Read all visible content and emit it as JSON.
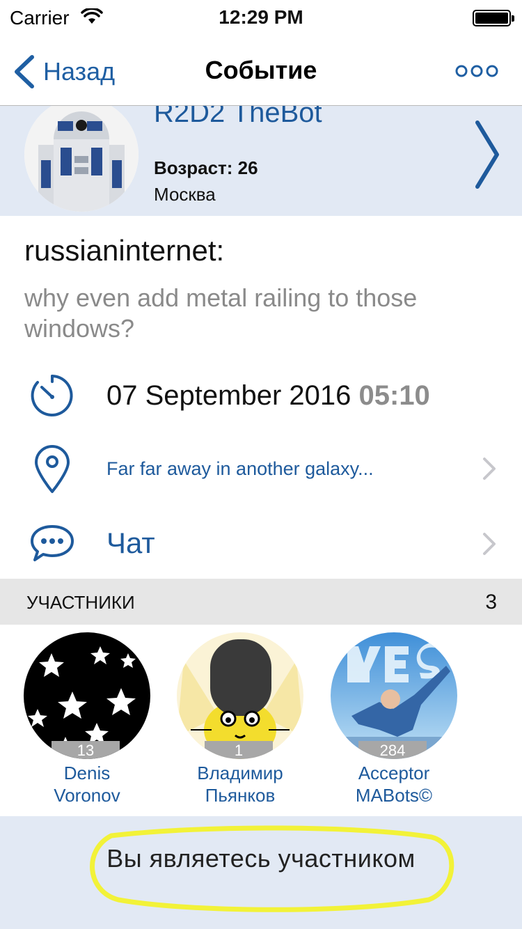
{
  "status_bar": {
    "carrier": "Carrier",
    "time": "12:29 PM"
  },
  "nav": {
    "back_label": "Назад",
    "title": "Событие",
    "more_icon": "more-dots-icon"
  },
  "profile": {
    "name": "R2D2 TheBot",
    "age": "Возраст: 26",
    "city": "Москва",
    "avatar": "r2d2-avatar"
  },
  "post": {
    "author": "russianinternet:",
    "text": "why even add metal railing to those windows?"
  },
  "event": {
    "date": "07 September 2016",
    "time": "05:10",
    "location": "Far far away in another galaxy...",
    "chat_label": "Чат"
  },
  "participants": {
    "label": "УЧАСТНИКИ",
    "count": "3",
    "items": [
      {
        "first": "Denis",
        "last": "Voronov",
        "badge": "13"
      },
      {
        "first": "Владимир",
        "last": "Пьянков",
        "badge": "1"
      },
      {
        "first": "Acceptor",
        "last": "MABots©",
        "badge": "284"
      }
    ]
  },
  "footer": {
    "status": "Вы являетесь участником"
  },
  "colors": {
    "accent": "#1e5a9c",
    "profile_bg": "#e2e9f4",
    "section_bg": "#e6e6e6",
    "highlight": "#f2f238"
  }
}
